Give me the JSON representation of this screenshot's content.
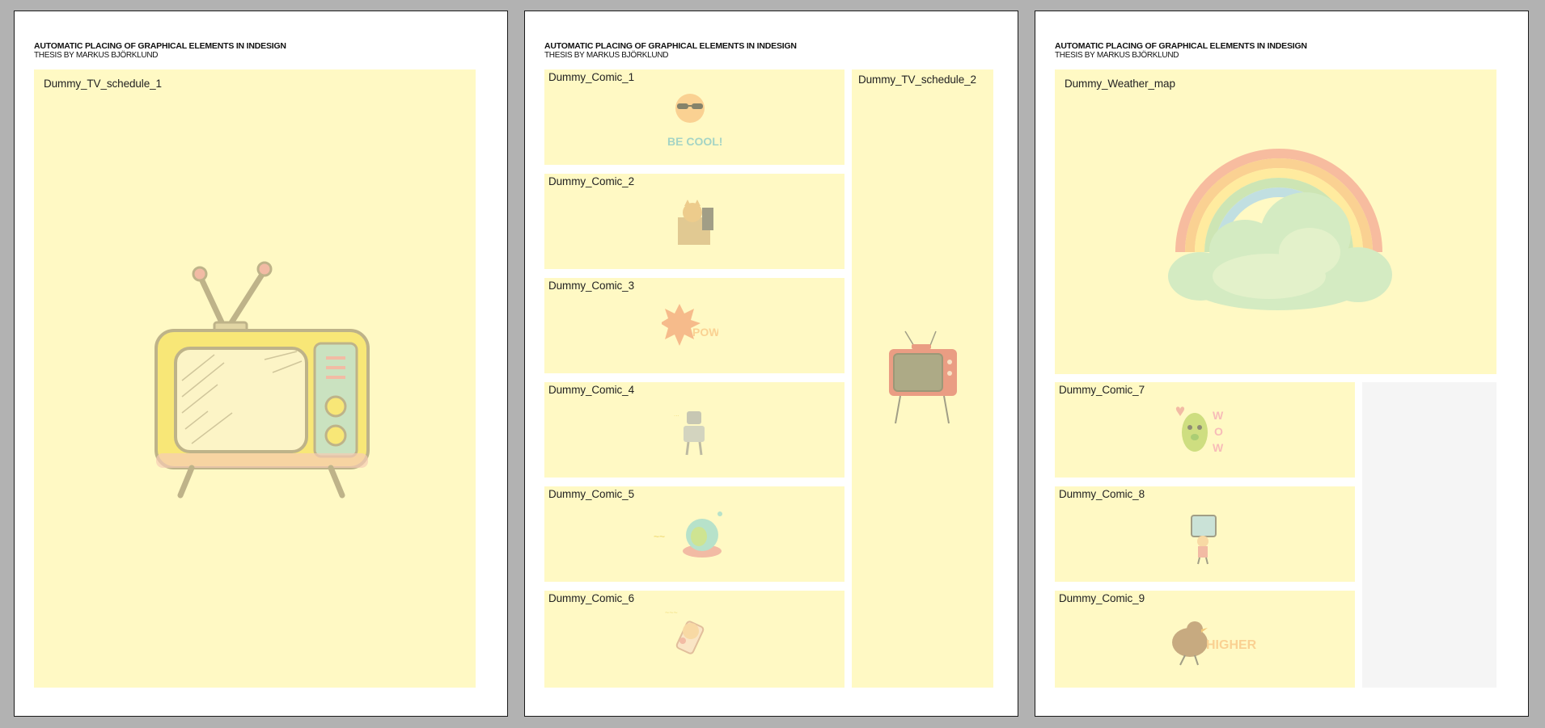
{
  "document": {
    "header_title": "AUTOMATIC PLACING OF GRAPHICAL ELEMENTS IN INDESIGN",
    "header_subtitle": "THESIS BY MARKUS BJÖRKLUND"
  },
  "pages": [
    {
      "frames": [
        {
          "label": "Dummy_TV_schedule_1",
          "icon": "retro-tv-icon"
        }
      ]
    },
    {
      "frames": [
        {
          "label": "Dummy_Comic_1",
          "icon": "cool-sun-sunglasses-icon",
          "caption": "BE COOL!"
        },
        {
          "label": "Dummy_Comic_2",
          "icon": "cat-with-box-icon"
        },
        {
          "label": "Dummy_Comic_3",
          "icon": "explosion-pow-icon",
          "caption": "POW!"
        },
        {
          "label": "Dummy_Comic_4",
          "icon": "robot-icon"
        },
        {
          "label": "Dummy_Comic_5",
          "icon": "alien-ufo-icon"
        },
        {
          "label": "Dummy_Comic_6",
          "icon": "character-sleeping-icon"
        },
        {
          "label": "Dummy_TV_schedule_2",
          "icon": "vintage-tv-icon"
        }
      ]
    },
    {
      "frames": [
        {
          "label": "Dummy_Weather_map",
          "icon": "rainbow-cloud-icon"
        },
        {
          "label": "Dummy_Comic_7",
          "icon": "cactus-wow-icon",
          "caption": "WOW"
        },
        {
          "label": "Dummy_Comic_8",
          "icon": "character-with-sign-icon"
        },
        {
          "label": "Dummy_Comic_9",
          "icon": "bird-higher-icon",
          "caption": "HIGHER"
        },
        {
          "label": "",
          "icon": "empty-frame"
        }
      ]
    }
  ],
  "colors": {
    "pasteboard": "#b2b2b2",
    "page": "#ffffff",
    "frame_fill": "#fff9c4",
    "empty_frame_fill": "#f5f5f5"
  }
}
